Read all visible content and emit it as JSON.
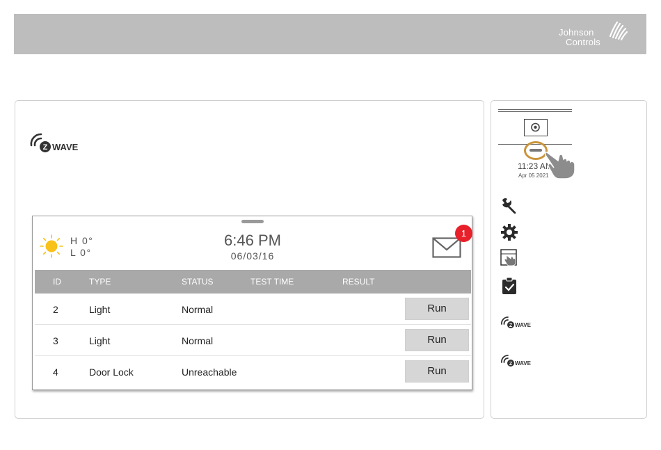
{
  "brand": {
    "line1": "Johnson",
    "line2": "Controls"
  },
  "zwave": {
    "label": "WAVE"
  },
  "device": {
    "weather": {
      "high": "H 0°",
      "low": "L 0°"
    },
    "time": "6:46 PM",
    "date": "06/03/16",
    "notification_count": "1",
    "table": {
      "headers": [
        "ID",
        "TYPE",
        "STATUS",
        "TEST TIME",
        "RESULT"
      ],
      "rows": [
        {
          "id": "2",
          "type": "Light",
          "status": "Normal",
          "test_time": "",
          "result": "",
          "action": "Run"
        },
        {
          "id": "3",
          "type": "Light",
          "status": "Normal",
          "test_time": "",
          "result": "",
          "action": "Run"
        },
        {
          "id": "4",
          "type": "Door Lock",
          "status": "Unreachable",
          "test_time": "",
          "result": "",
          "action": "Run"
        }
      ]
    }
  },
  "side": {
    "mini_time": "11:23 AM",
    "mini_date": "Apr 05 2021",
    "icons": [
      "wrench-icon",
      "gear-icon",
      "touch-screen-icon",
      "clipboard-check-icon",
      "zwave-icon",
      "zwave-icon"
    ]
  },
  "colors": {
    "banner": "#bdbdbd",
    "table_header": "#a9a9a9",
    "badge": "#e8202a",
    "pull_ring": "#c9953b",
    "sun": "#f7c21a"
  }
}
